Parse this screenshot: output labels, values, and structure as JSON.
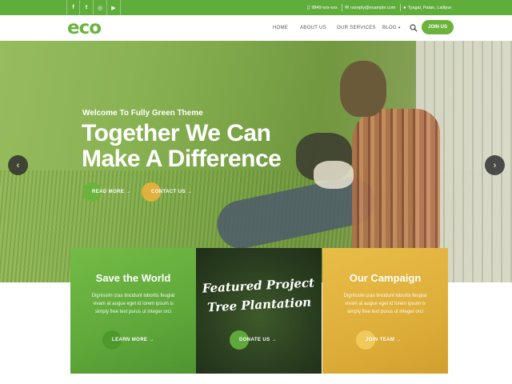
{
  "topbar": {
    "social": [
      {
        "name": "facebook",
        "glyph": "f"
      },
      {
        "name": "twitter",
        "glyph": "t"
      },
      {
        "name": "instagram",
        "glyph": "◎"
      },
      {
        "name": "youtube",
        "glyph": "▶"
      }
    ],
    "phone": "9849-xxx-xxx",
    "email": "noreply@example.com",
    "address": "Tyagal, Patan, Lalitpur"
  },
  "header": {
    "logo": "eco",
    "nav": [
      "HOME",
      "ABOUT US",
      "OUR SERVICES",
      "BLOG"
    ],
    "join_label": "JOIN US"
  },
  "hero": {
    "subtitle": "Welcome To Fully Green Theme",
    "title_line1": "Together We Can",
    "title_line2": "Make A Difference",
    "read_more": "READ MORE →",
    "contact_us": "CONTACT US →"
  },
  "features": [
    {
      "title": "Save the World",
      "text": "Dignissim cras tincidunt lobortis feugiat vivam at augue eget id lorem ipsum is simply free text purus ut integer orci",
      "button": "LEARN MORE →"
    },
    {
      "title_line1": "Featured Project",
      "title_line2": "Tree Plantation",
      "button": "DONATE US →"
    },
    {
      "title": "Our Campaign",
      "text": "Dignissim cras tincidunt lobortis feugiat vivam at augue eget id lorem ipsum is simply free text purus ut integer orci",
      "button": "JOIN TEAM →"
    }
  ],
  "colors": {
    "green": "#6cb33e",
    "topbar_green": "#5fae3c",
    "dark_green": "#2b3f20",
    "amber": "#e0b13e"
  }
}
